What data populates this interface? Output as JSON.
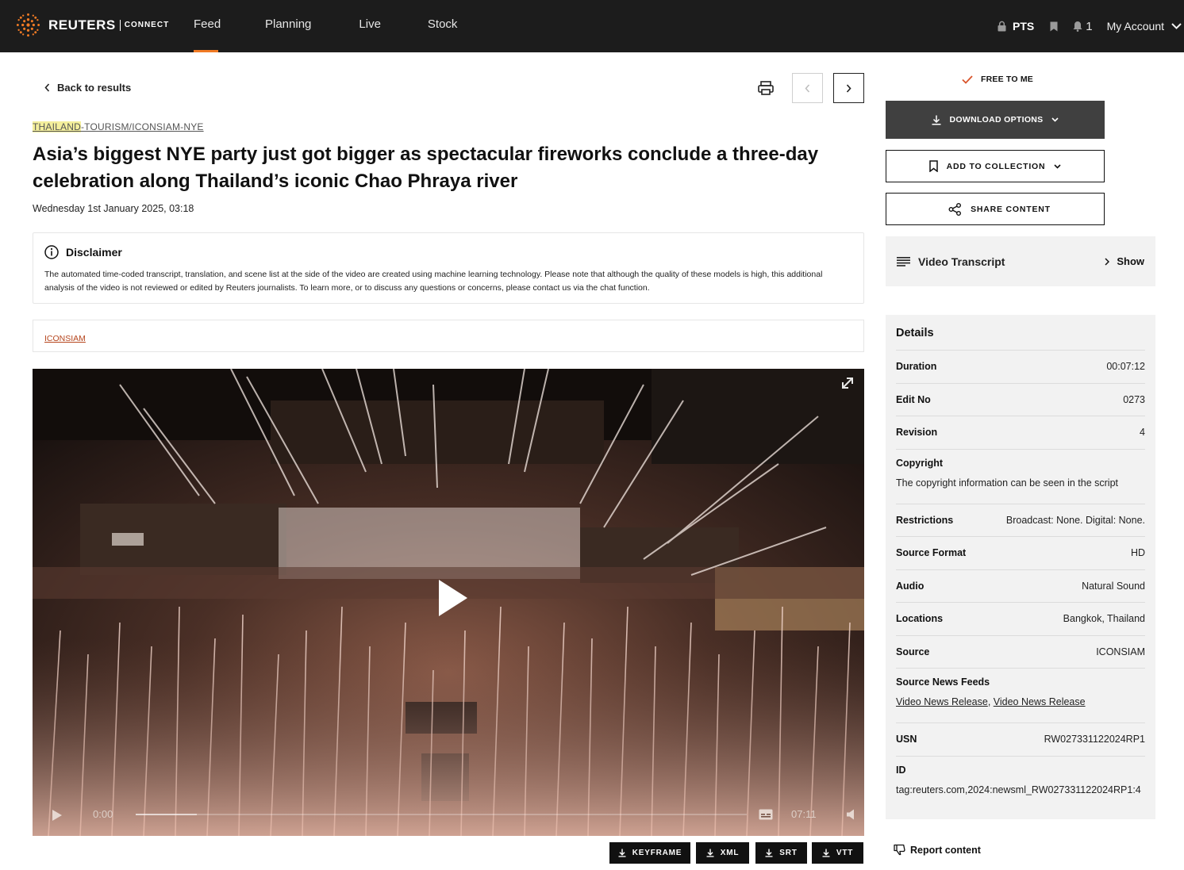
{
  "brand": {
    "name": "REUTERS",
    "sub": "CONNECT"
  },
  "nav": {
    "items": [
      {
        "label": "Feed",
        "active": true
      },
      {
        "label": "Planning"
      },
      {
        "label": "Live"
      },
      {
        "label": "Stock"
      }
    ],
    "pts_label": "PTS",
    "notification_count": "1",
    "account_label": "My Account"
  },
  "article": {
    "back_label": "Back to results",
    "slug_highlight": "THAILAND",
    "slug_rest": "-TOURISM/ICONSIAM-NYE",
    "headline": "Asia’s biggest NYE party just got bigger as spectacular fireworks conclude a three-day celebration along Thailand’s iconic Chao Phraya river",
    "dateline": "Wednesday 1st January 2025, 03:18",
    "disclaimer_title": "Disclaimer",
    "disclaimer_text": "The automated time-coded transcript, translation, and scene list at the side of the video are created using machine learning technology. Please note that although the quality of these models is high, this additional analysis of the video is not reviewed or edited by Reuters journalists. To learn more, or to discuss any questions or concerns, please contact us via the chat function.",
    "tag": "ICONSIAM"
  },
  "player": {
    "current_time": "0:00",
    "duration": "07:11",
    "progress": 0,
    "buffered": 0.1
  },
  "downloads": [
    "KEYFRAME",
    "XML",
    "SRT",
    "VTT"
  ],
  "sidebar": {
    "free_label": "FREE TO ME",
    "download_options_label": "DOWNLOAD OPTIONS",
    "add_to_collection_label": "ADD TO COLLECTION",
    "share_label": "SHARE CONTENT",
    "transcript_label": "Video Transcript",
    "transcript_toggle": "Show",
    "details_title": "Details",
    "details": {
      "duration": {
        "k": "Duration",
        "v": "00:07:12"
      },
      "edit_no": {
        "k": "Edit No",
        "v": "0273"
      },
      "revision": {
        "k": "Revision",
        "v": "4"
      },
      "copyright": {
        "k": "Copyright",
        "v": "The copyright information can be seen in the script"
      },
      "restrictions": {
        "k": "Restrictions",
        "v": "Broadcast: None. Digital: None."
      },
      "source_format": {
        "k": "Source Format",
        "v": "HD"
      },
      "audio": {
        "k": "Audio",
        "v": "Natural Sound"
      },
      "locations": {
        "k": "Locations",
        "v": "Bangkok, Thailand"
      },
      "source": {
        "k": "Source",
        "v": "ICONSIAM"
      },
      "source_news_feeds": {
        "k": "Source News Feeds",
        "feed1": "Video News Release",
        "feed2": "Video News Release"
      },
      "usn": {
        "k": "USN",
        "v": "RW027331122024RP1"
      },
      "id": {
        "k": "ID",
        "v": "tag:reuters.com,2024:newsml_RW027331122024RP1:4"
      }
    },
    "report_label": "Report content"
  },
  "colors": {
    "accent": "#f07a24",
    "topbar": "#1c1c1c",
    "tag": "#b6461e",
    "check": "#d9542b"
  }
}
